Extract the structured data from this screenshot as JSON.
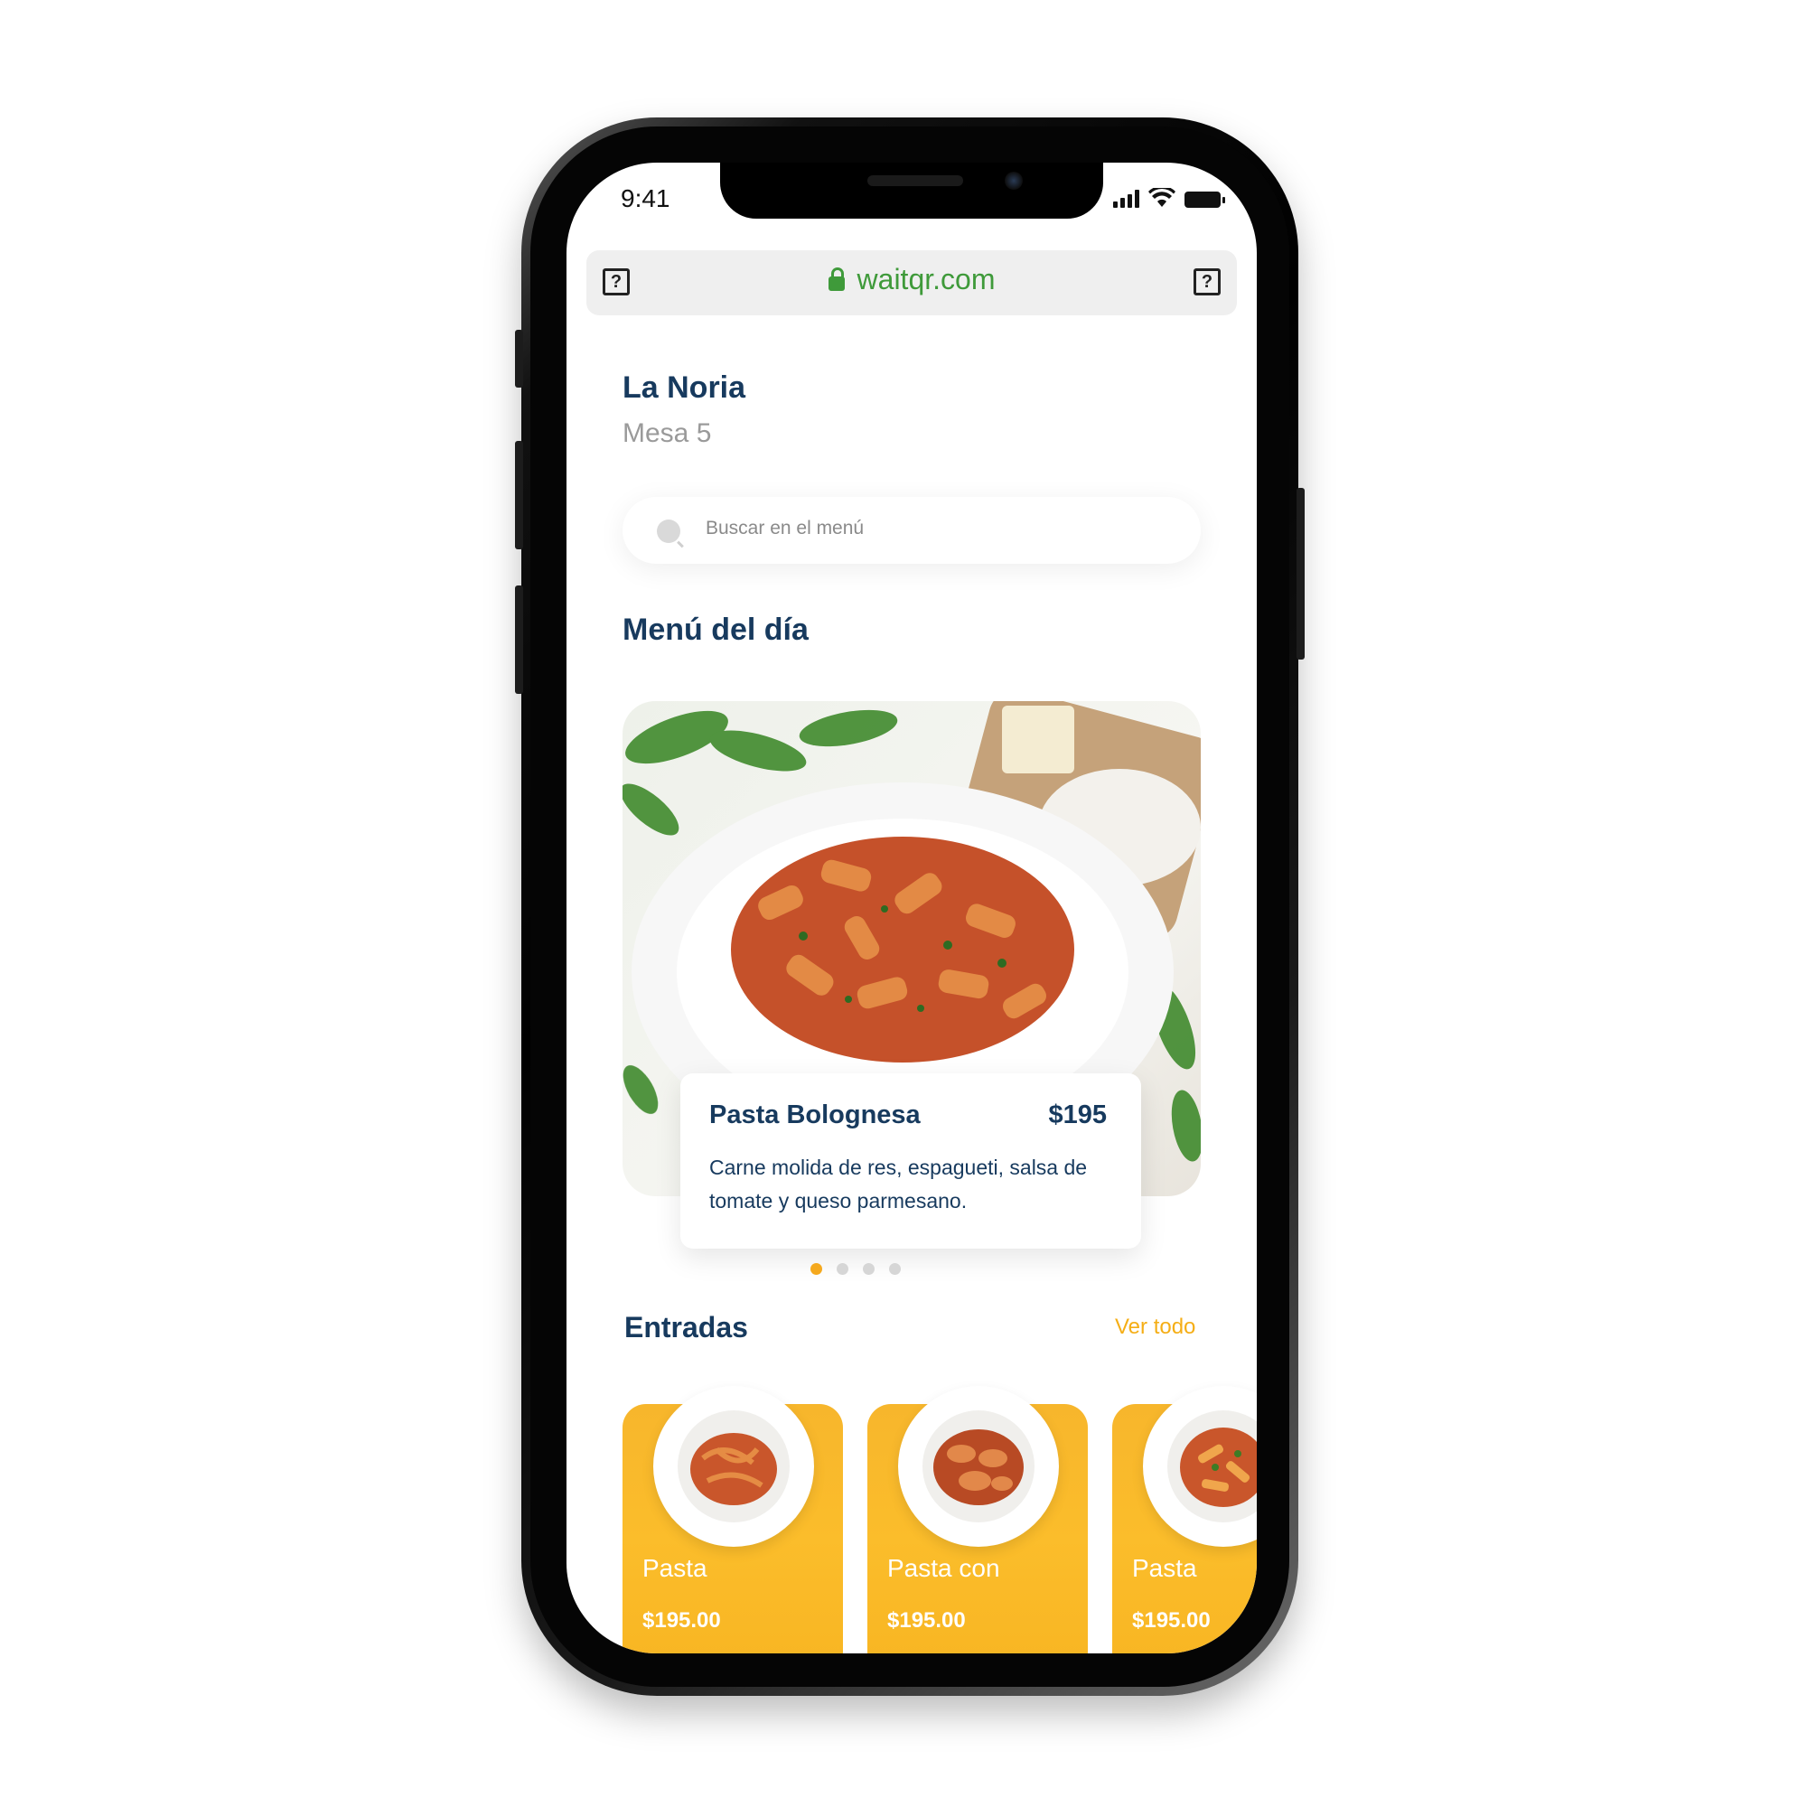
{
  "status_bar": {
    "time": "9:41"
  },
  "browser": {
    "url": "waitqr.com",
    "left_button": "?",
    "right_button": "?"
  },
  "restaurant": {
    "name": "La Noria",
    "table": "Mesa 5"
  },
  "search": {
    "placeholder": "Buscar en el menú"
  },
  "daily_menu": {
    "title": "Menú del día",
    "dish": {
      "name": "Pasta Bolognesa",
      "price": "$195",
      "description": "Carne molida de res, espagueti, salsa de tomate y queso parmesano."
    },
    "carousel_pages": 4,
    "active_page": 1
  },
  "starters": {
    "title": "Entradas",
    "see_all": "Ver todo",
    "items": [
      {
        "name": "Pasta",
        "price": "$195.00"
      },
      {
        "name": "Pasta con",
        "price": "$195.00"
      },
      {
        "name": "Pasta",
        "price": "$195.00"
      }
    ]
  },
  "colors": {
    "accent": "#f5ae16",
    "title": "#173a5e",
    "url": "#3f9a3a"
  }
}
